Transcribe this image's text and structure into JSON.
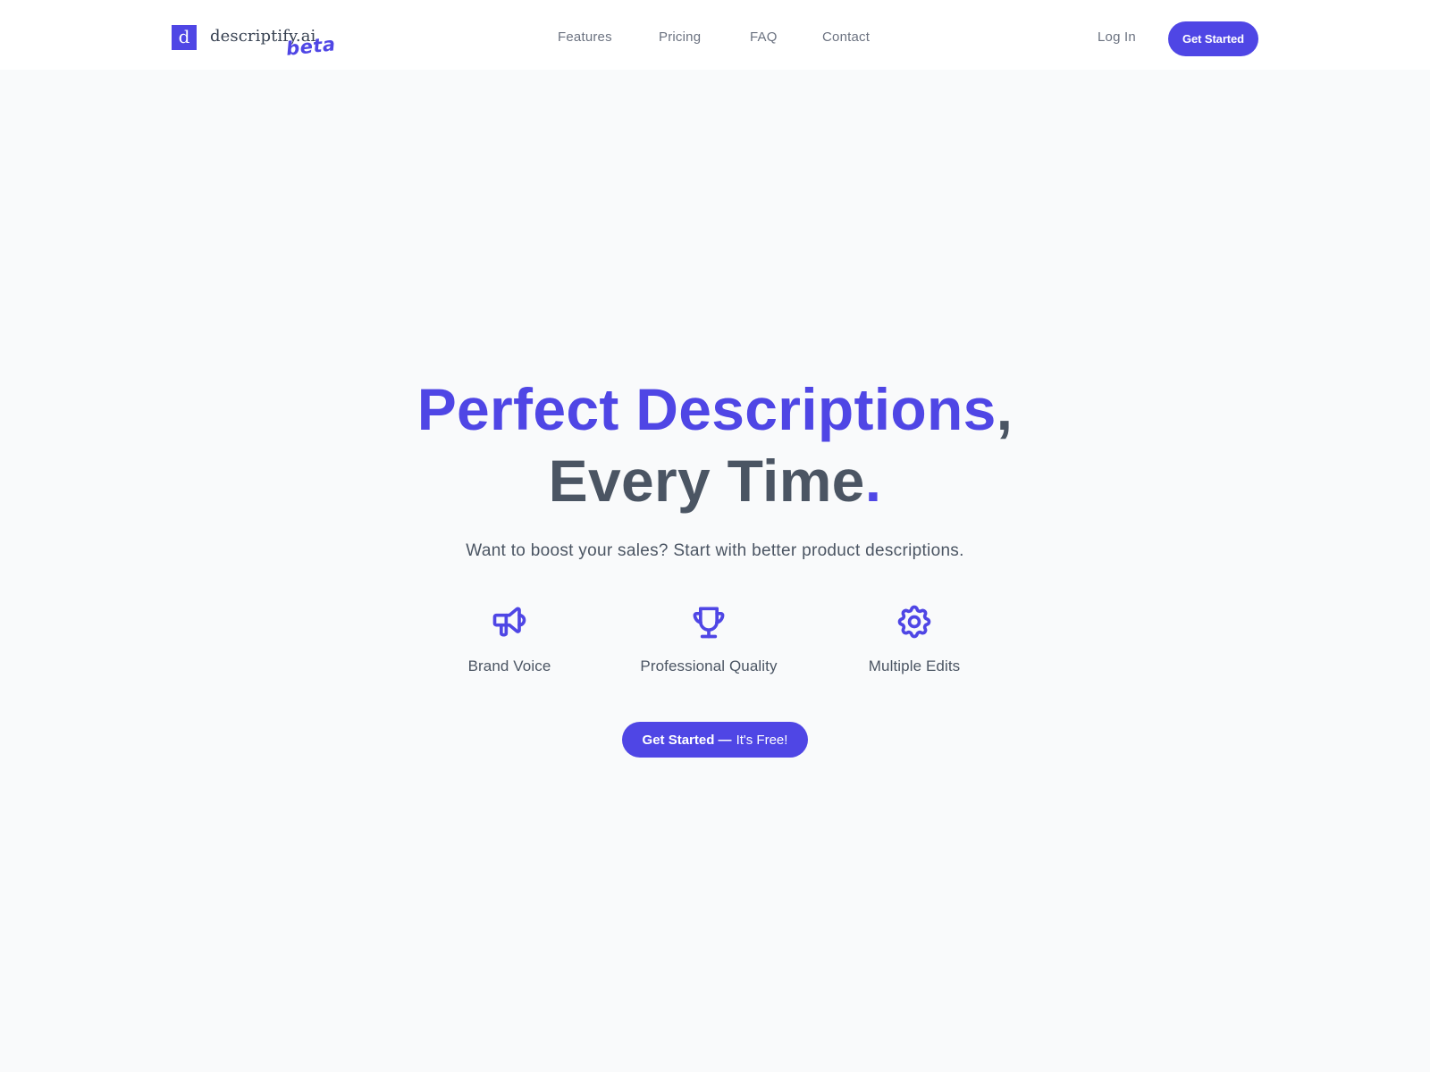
{
  "header": {
    "logo": {
      "mark": "d",
      "name": "descriptify.ai",
      "badge": "beta"
    },
    "nav": [
      {
        "label": "Features"
      },
      {
        "label": "Pricing"
      },
      {
        "label": "FAQ"
      },
      {
        "label": "Contact"
      }
    ],
    "login_label": "Log In",
    "cta_label": "Get Started"
  },
  "hero": {
    "headline_line1": "Perfect Descriptions",
    "headline_line1_punct": ",",
    "headline_line2": "Every Time",
    "headline_line2_punct": ".",
    "subtitle": "Want to boost your sales? Start with better product descriptions.",
    "features": [
      {
        "icon": "megaphone-icon",
        "label": "Brand Voice"
      },
      {
        "icon": "trophy-icon",
        "label": "Professional Quality"
      },
      {
        "icon": "gear-icon",
        "label": "Multiple Edits"
      }
    ],
    "cta_strong": "Get Started —",
    "cta_light": "It's Free!"
  },
  "colors": {
    "brand": "#4f46e5",
    "text": "#4b5563",
    "muted": "#6b7280",
    "background": "#f9fafb",
    "header_bg": "#ffffff"
  }
}
